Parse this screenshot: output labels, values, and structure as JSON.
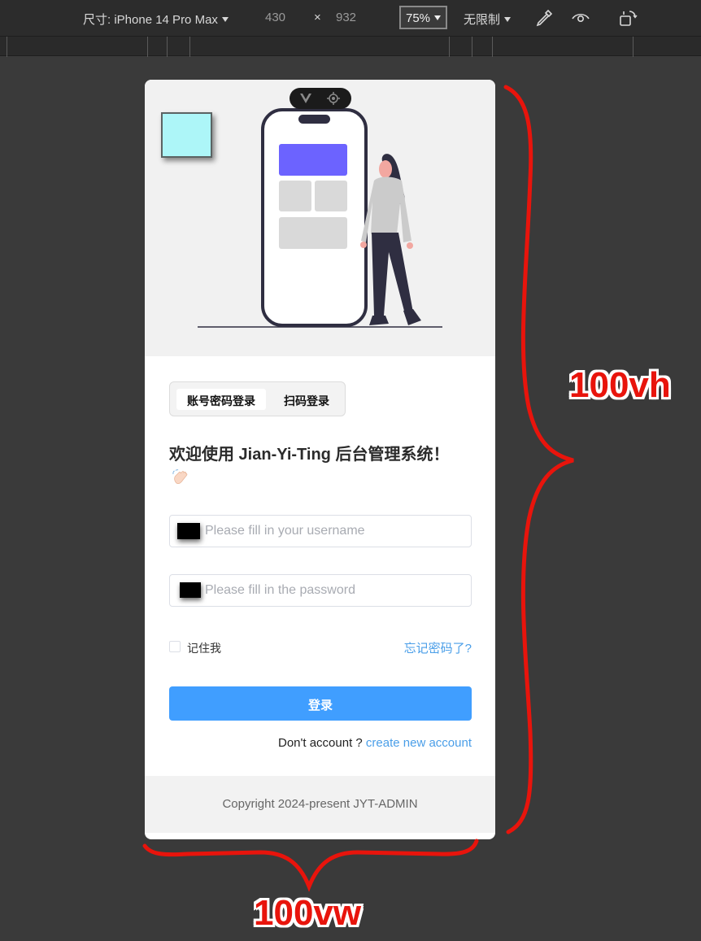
{
  "toolbar": {
    "device_label": "尺寸: iPhone 14 Pro Max",
    "width": "430",
    "times": "×",
    "height": "932",
    "zoom": "75%",
    "throttle": "无限制"
  },
  "phone": {
    "tabs": [
      "账号密码登录",
      "扫码登录"
    ],
    "welcome": "欢迎使用 Jian-Yi-Ting 后台管理系统！",
    "username_placeholder": "Please fill in your username",
    "password_placeholder": "Please fill in the password",
    "remember_label": "记住我",
    "forgot_label": "忘记密码了?",
    "login_label": "登录",
    "register_question": "Don't account ?",
    "register_link": "create new account",
    "copyright": "Copyright 2024-present JYT-ADMIN"
  },
  "annotations": {
    "height_label": "100vh",
    "width_label": "100vw"
  },
  "colors": {
    "accent": "#409eff",
    "link": "#4a9ee8",
    "annotation": "#e8140c",
    "illustration_purple": "#6c63ff"
  },
  "icons": [
    "vue-logo-icon",
    "camera-icon",
    "chevron-down-icon",
    "eyedropper-icon",
    "eye-icon",
    "rotate-device-icon",
    "waving-hand-icon",
    "user-icon",
    "lock-icon"
  ]
}
